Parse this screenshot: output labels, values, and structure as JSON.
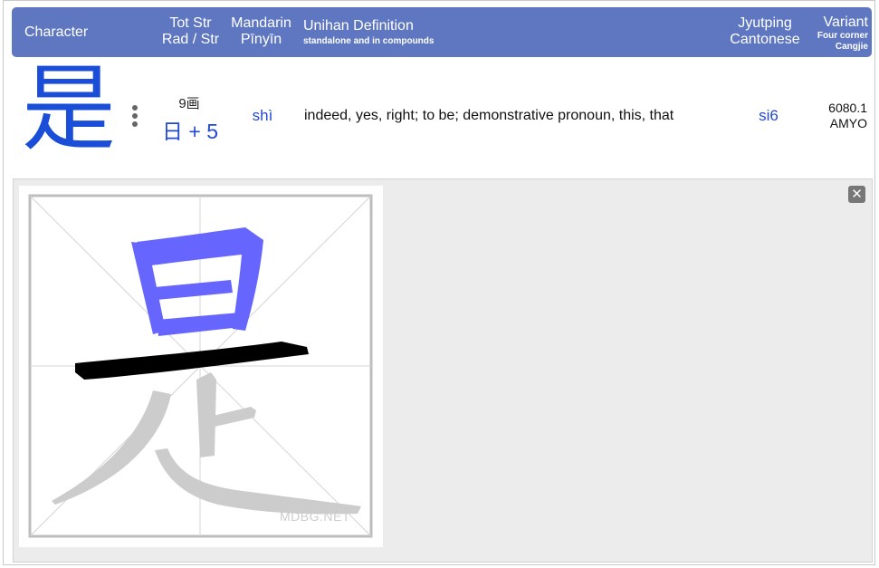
{
  "header": {
    "character": "Character",
    "tot_str": "Tot Str",
    "rad_str": "Rad / Str",
    "mandarin": "Mandarin",
    "pinyin": "Pīnyīn",
    "unihan": "Unihan Definition",
    "unihan_sub": "standalone and in compounds",
    "jyutping": "Jyutping",
    "cantonese": "Cantonese",
    "variant": "Variant",
    "four_corner": "Four corner",
    "cangjie": "Cangjie"
  },
  "entry": {
    "character": "是",
    "strokes": "9画",
    "radical": "日 + 5",
    "pinyin": "shì",
    "definition": "indeed, yes, right; to be; demonstrative pronoun, this, that",
    "jyutping": "si6",
    "four_corner": "6080.1",
    "cangjie": "AMYO"
  },
  "stroke_panel": {
    "close_icon": "close-icon",
    "watermark": "MDBG.NET",
    "current_stroke_color": "#000000",
    "done_stroke_color": "#6666ff",
    "pending_stroke_color": "#cccccc"
  },
  "colors": {
    "header_bg": "#5e77c0",
    "link_blue": "#2349d0",
    "char_blue": "#1a4dd8"
  }
}
